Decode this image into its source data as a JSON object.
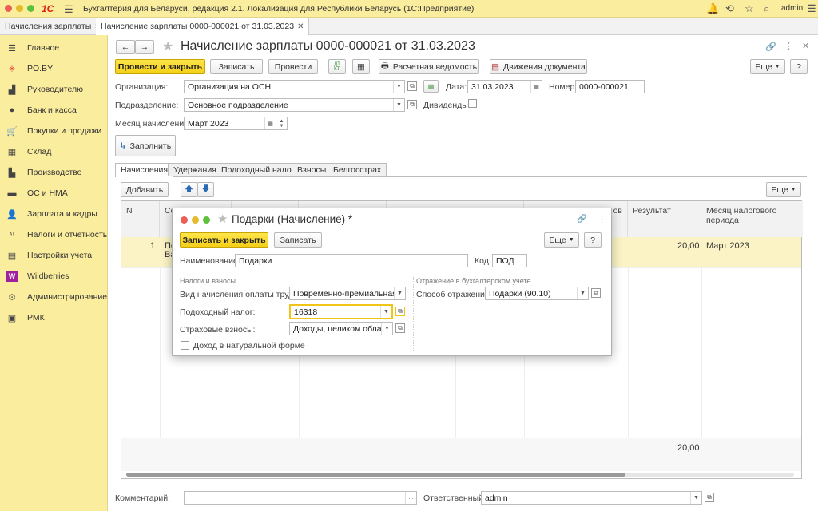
{
  "app": {
    "title": "Бухгалтерия для Беларуси, редакция 2.1. Локализация для Республики Беларусь  (1С:Предприятие)",
    "logo": "1С",
    "user": "admin"
  },
  "tabs": [
    {
      "label": "Начисления зарплаты"
    },
    {
      "label": "Начисление зарплаты 0000-000021 от 31.03.2023"
    }
  ],
  "sidebar": {
    "items": [
      {
        "label": "Главное",
        "icon": "menu-icon"
      },
      {
        "label": "PO.BY",
        "icon": "asterisk-icon"
      },
      {
        "label": "Руководителю",
        "icon": "chart-icon"
      },
      {
        "label": "Банк и касса",
        "icon": "coin-icon"
      },
      {
        "label": "Покупки и продажи",
        "icon": "cart-icon"
      },
      {
        "label": "Склад",
        "icon": "grid-icon"
      },
      {
        "label": "Производство",
        "icon": "factory-icon"
      },
      {
        "label": "ОС и НМА",
        "icon": "truck-icon"
      },
      {
        "label": "Зарплата и кадры",
        "icon": "person-icon"
      },
      {
        "label": "Налоги и отчетность",
        "icon": "tax-icon"
      },
      {
        "label": "Настройки учета",
        "icon": "settings-icon"
      },
      {
        "label": "Wildberries",
        "icon": "wb-icon"
      },
      {
        "label": "Администрирование",
        "icon": "gear-icon"
      },
      {
        "label": "РМК",
        "icon": "register-icon"
      }
    ]
  },
  "doc": {
    "title": "Начисление зарплаты 0000-000021 от 31.03.2023",
    "toolbar": {
      "post_close": "Провести и закрыть",
      "save": "Записать",
      "post": "Провести",
      "payroll": "Расчетная ведомость",
      "movements": "Движения документа",
      "more": "Еще",
      "help": "?"
    },
    "org_label": "Организация:",
    "org_value": "Организация на ОСН",
    "date_label": "Дата:",
    "date_value": "31.03.2023",
    "num_label": "Номер:",
    "num_value": "0000-000021",
    "dept_label": "Подразделение:",
    "dept_value": "Основное подразделение",
    "div_label": "Дивиденды:",
    "month_label": "Месяц начисления:",
    "month_value": "Март 2023",
    "fill": "Заполнить",
    "form_tabs": [
      "Начисления",
      "Удержания",
      "Подоходный налог",
      "Взносы",
      "Белгосстрах"
    ],
    "add": "Добавить",
    "more2": "Еще",
    "grid": {
      "col_n": "N",
      "col_result": "Результат",
      "col_month": "Месяц налогового периода",
      "row_n": "1",
      "row_result": "20,00",
      "row_month": "Март 2023",
      "total": "20,00",
      "partial_col": "Со",
      "partial_row1": "Пе",
      "partial_row2": "Ва",
      "partial_hdr": "ов"
    },
    "comment_label": "Комментарий:",
    "resp_label": "Ответственный:",
    "resp_value": "admin"
  },
  "modal": {
    "title": "Подарки (Начисление) *",
    "save_close": "Записать и закрыть",
    "save": "Записать",
    "more": "Еще",
    "help": "?",
    "name_label": "Наименование:",
    "name_value": "Подарки",
    "code_label": "Код:",
    "code_value": "ПОД",
    "sec1": "Налоги и взносы",
    "sec2": "Отражение в бухгалтерском учете",
    "kind_label": "Вид начисления оплаты труда:",
    "kind_value": "Повременно-премиальная оп",
    "tax_label": "Подоходный налог:",
    "tax_value": "16318",
    "ins_label": "Страховые взносы:",
    "ins_value": "Доходы, целиком облагае",
    "natural_label": "Доход в натуральной форме",
    "method_label": "Способ отражения:",
    "method_value": "Подарки (90.10)"
  }
}
